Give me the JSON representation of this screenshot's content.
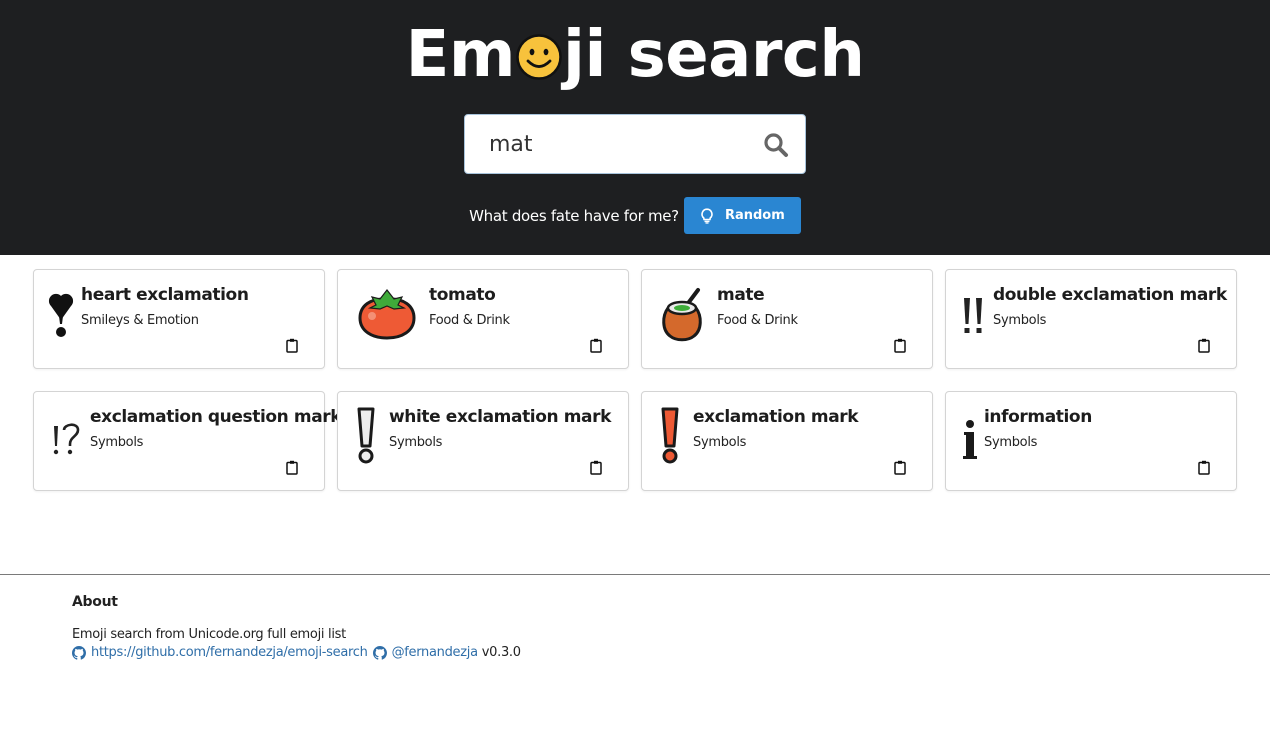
{
  "header": {
    "title_before": "Em",
    "title_after": "ji search",
    "title_icon": "smiley-face-icon",
    "search": {
      "value": "mat",
      "placeholder": "",
      "icon": "search-icon"
    },
    "fate_text": "What does fate have for me?",
    "random_button": {
      "label": "Random",
      "icon": "lightbulb-icon",
      "color": "#2a86d2"
    }
  },
  "results": [
    {
      "emoji": "heart-exclamation",
      "name": "heart exclamation",
      "category": "Smileys & Emotion"
    },
    {
      "emoji": "tomato",
      "name": "tomato",
      "category": "Food & Drink"
    },
    {
      "emoji": "mate",
      "name": "mate",
      "category": "Food & Drink"
    },
    {
      "emoji": "double-exclamation-mark",
      "name": "double exclamation mark",
      "category": "Symbols"
    },
    {
      "emoji": "exclamation-question-mark",
      "name": "exclamation question mark",
      "category": "Symbols"
    },
    {
      "emoji": "white-exclamation-mark",
      "name": "white exclamation mark",
      "category": "Symbols"
    },
    {
      "emoji": "exclamation-mark",
      "name": "exclamation mark",
      "category": "Symbols"
    },
    {
      "emoji": "information",
      "name": "information",
      "category": "Symbols"
    }
  ],
  "footer": {
    "about_title": "About",
    "description": "Emoji search from Unicode.org full emoji list",
    "repo_link": "https://github.com/fernandezja/emoji-search",
    "author_link": "@fernandezja",
    "version": "v0.3.0"
  }
}
